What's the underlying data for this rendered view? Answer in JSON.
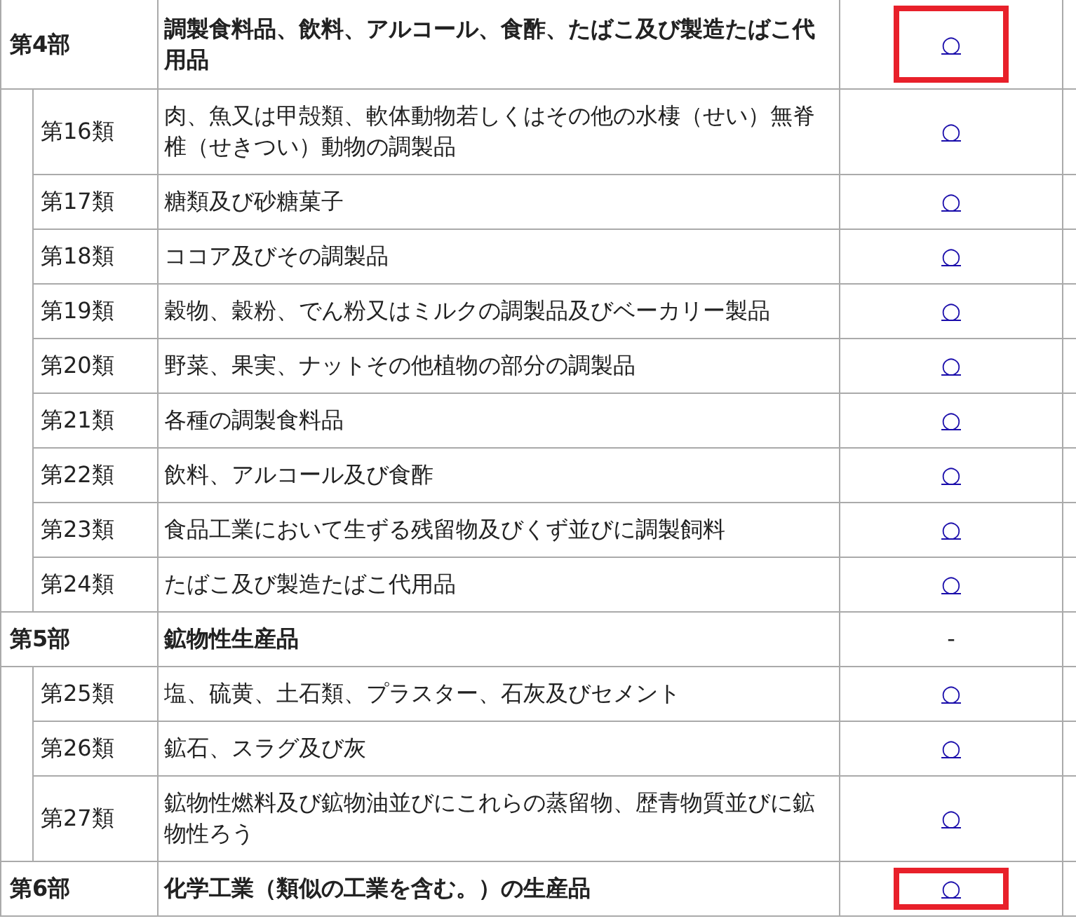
{
  "sections": [
    {
      "label": "第4部",
      "title": "調製食料品、飲料、アルコール、食酢、たばこ及び製造たばこ代用品",
      "mark": "○",
      "linked": true,
      "highlighted": true,
      "children": [
        {
          "label": "第16類",
          "title": "肉、魚又は甲殻類、軟体動物若しくはその他の水棲（せい）無脊椎（せきつい）動物の調製品",
          "mark": "○",
          "linked": true
        },
        {
          "label": "第17類",
          "title": "糖類及び砂糖菓子",
          "mark": "○",
          "linked": true
        },
        {
          "label": "第18類",
          "title": "ココア及びその調製品",
          "mark": "○",
          "linked": true
        },
        {
          "label": "第19類",
          "title": "穀物、穀粉、でん粉又はミルクの調製品及びベーカリー製品",
          "mark": "○",
          "linked": true
        },
        {
          "label": "第20類",
          "title": "野菜、果実、ナットその他植物の部分の調製品",
          "mark": "○",
          "linked": true
        },
        {
          "label": "第21類",
          "title": "各種の調製食料品",
          "mark": "○",
          "linked": true
        },
        {
          "label": "第22類",
          "title": "飲料、アルコール及び食酢",
          "mark": "○",
          "linked": true
        },
        {
          "label": "第23類",
          "title": "食品工業において生ずる残留物及びくず並びに調製飼料",
          "mark": "○",
          "linked": true
        },
        {
          "label": "第24類",
          "title": "たばこ及び製造たばこ代用品",
          "mark": "○",
          "linked": true
        }
      ]
    },
    {
      "label": "第5部",
      "title": "鉱物性生産品",
      "mark": "-",
      "linked": false,
      "highlighted": false,
      "children": [
        {
          "label": "第25類",
          "title": "塩、硫黄、土石類、プラスター、石灰及びセメント",
          "mark": "○",
          "linked": true
        },
        {
          "label": "第26類",
          "title": "鉱石、スラグ及び灰",
          "mark": "○",
          "linked": true
        },
        {
          "label": "第27類",
          "title": "鉱物性燃料及び鉱物油並びにこれらの蒸留物、歴青物質並びに鉱物性ろう",
          "mark": "○",
          "linked": true
        }
      ]
    },
    {
      "label": "第6部",
      "title": "化学工業（類似の工業を含む。）の生産品",
      "mark": "○",
      "linked": true,
      "highlighted": true
    }
  ]
}
